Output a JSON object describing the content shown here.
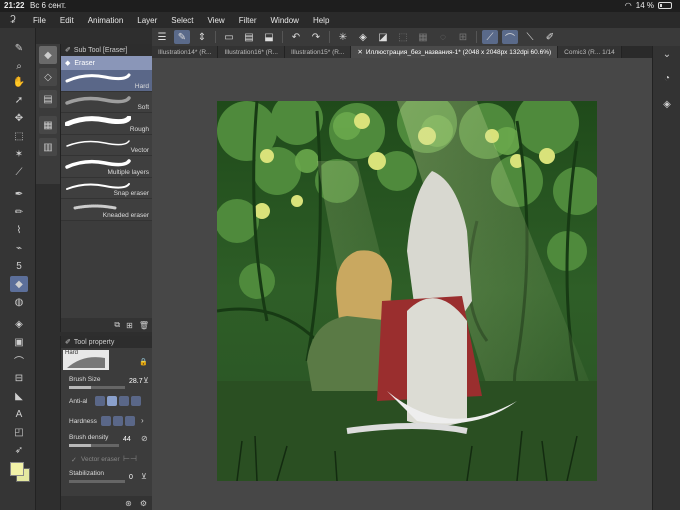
{
  "status": {
    "time": "21:22",
    "date": "Вс 6 сент.",
    "battery": "14 %"
  },
  "menu": {
    "items": [
      "File",
      "Edit",
      "Animation",
      "Layer",
      "Select",
      "View",
      "Filter",
      "Window",
      "Help"
    ]
  },
  "toolbar": {
    "icons": [
      "menu-icon",
      "pen-pressure-icon",
      "stabilizer-icon",
      "new-file-icon",
      "open-file-icon",
      "save-icon",
      "undo-icon",
      "redo-icon",
      "clear-icon",
      "fill-icon",
      "transform-icon",
      "snap-icon",
      "ruler-icon",
      "lasso-icon",
      "stroke-icon",
      "stroke-curve-icon",
      "stroke-line-icon",
      "edit-icon"
    ]
  },
  "tabs": [
    {
      "label": "Illustration14* (R..."
    },
    {
      "label": "Illustration16* (R..."
    },
    {
      "label": "Illustration15* (R..."
    },
    {
      "label": "Иллюстрация_без_названия-1* (2048 x 2048px 132dpi 60.6%)",
      "active": true
    },
    {
      "label": "Comic3 (R... 1/14"
    }
  ],
  "subtool_panel": {
    "title": "Sub Tool [Eraser]",
    "group": "Eraser",
    "brushes": [
      {
        "label": "Hard",
        "selected": true
      },
      {
        "label": "Soft"
      },
      {
        "label": "Rough"
      },
      {
        "label": "Vector"
      },
      {
        "label": "Multiple layers"
      },
      {
        "label": "Snap eraser"
      },
      {
        "label": "Kneaded eraser"
      }
    ]
  },
  "tool_property": {
    "title": "Tool property",
    "preset": "Hard",
    "brush_size_label": "Brush Size",
    "brush_size_value": "28.7",
    "antialias_label": "Anti-al",
    "hardness_label": "Hardness",
    "brush_density_label": "Brush density",
    "brush_density_value": "44",
    "vector_eraser_label": "Vector eraser",
    "stabilization_label": "Stabilization",
    "stabilization_value": "0"
  },
  "colors": {
    "main": "#f2f2a8",
    "sub": "#e4e8a0",
    "accent": "#5c6f9a"
  }
}
